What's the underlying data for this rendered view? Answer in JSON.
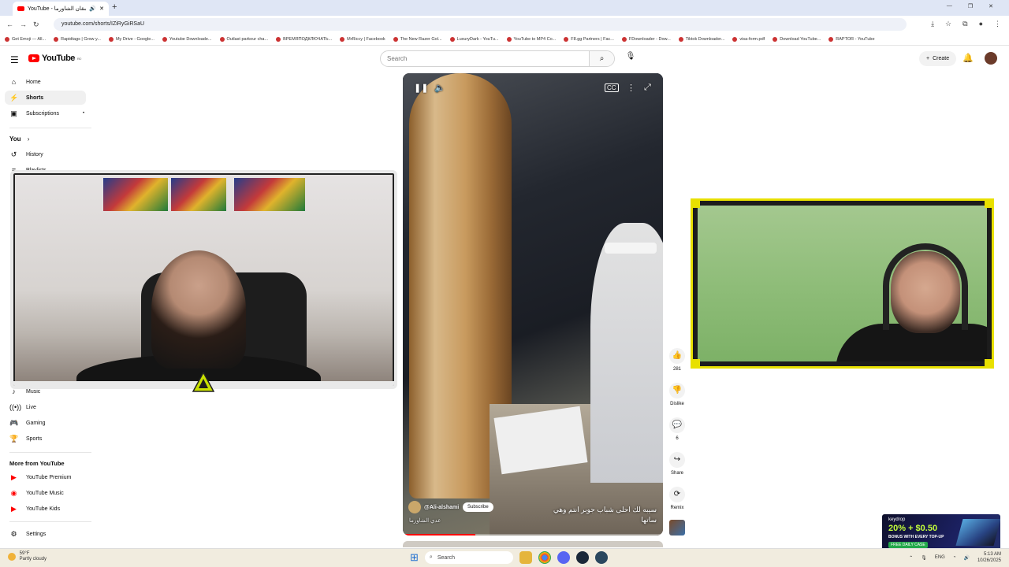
{
  "browser": {
    "tab_title": "YouTube - شقان الشاورما",
    "new_tab": "+",
    "url": "youtube.com/shorts/IZiRyGiRSaU",
    "window_controls": [
      "—",
      "❐",
      "✕"
    ],
    "bookmarks": [
      "Get Emoji — All...",
      "Rapidtags | Grow y...",
      "My Drive - Google...",
      "Youtube Downloade...",
      "Outlast parkour cha...",
      "ВРЕМЯПОДКЛЮЧАТЬ...",
      "MrRiccy | Facebook",
      "The New Razer Gol...",
      "LuxuryDark - YouTu...",
      "YouTube to MP4 Co...",
      "F8.gg Partners | Fac...",
      "FDownloader - Dow...",
      "Tiktok Downloader...",
      "visa-form.pdf",
      "Download YouTube...",
      "RAPTOR - YouTube"
    ]
  },
  "header": {
    "logo_text": "YouTube",
    "logo_sup": "RO",
    "search_placeholder": "Search",
    "create_label": "Create"
  },
  "sidebar": {
    "top": [
      {
        "label": "Home",
        "icon": "home-icon"
      },
      {
        "label": "Shorts",
        "icon": "shorts-icon"
      },
      {
        "label": "Subscriptions",
        "icon": "subscriptions-icon"
      }
    ],
    "you_heading": "You",
    "you_items": [
      {
        "label": "History",
        "icon": "history-icon"
      },
      {
        "label": "Playlists",
        "icon": "playlists-icon"
      }
    ],
    "explore_items": [
      {
        "label": "Music",
        "icon": "music-icon"
      },
      {
        "label": "Live",
        "icon": "live-icon"
      },
      {
        "label": "Gaming",
        "icon": "gaming-icon"
      },
      {
        "label": "Sports",
        "icon": "sports-icon"
      }
    ],
    "more_heading": "More from YouTube",
    "more_items": [
      {
        "label": "YouTube Premium"
      },
      {
        "label": "YouTube Music"
      },
      {
        "label": "YouTube Kids"
      }
    ],
    "settings_label": "Settings"
  },
  "short": {
    "channel": "@Ali-alshami",
    "subscribe_label": "Subscribe",
    "title": "عدي الشاورما",
    "caption_line1": "سيبه لك احلى شباب جوبر انتم وهي",
    "caption_line2": "ساتها",
    "progress": 0.28
  },
  "actions": {
    "like_count": "281",
    "dislike_label": "Dislike",
    "comment_count": "6",
    "share_label": "Share",
    "remix_label": "Remix"
  },
  "ad": {
    "brand": "keydrop",
    "promo": "20% + $0.50",
    "promo_sub": "BONUS WITH EVERY TOP-UP",
    "cta": "FREE DAILY CASE"
  },
  "taskbar": {
    "temp": "59°F",
    "weather": "Partly cloudy",
    "search_label": "Search",
    "lang": "ENG",
    "time": "5:13 AM",
    "date": "10/26/2025"
  }
}
